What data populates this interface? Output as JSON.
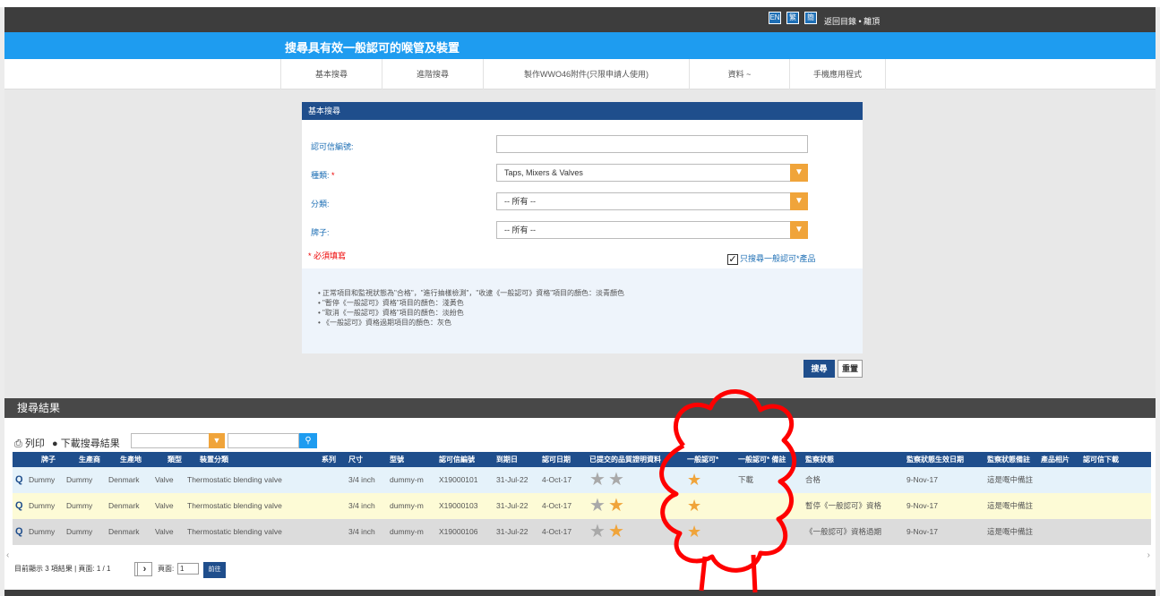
{
  "topbar": {
    "lang_en": "EN",
    "lang_sc": "繁",
    "lang_tc": "簡",
    "links": "返回目錄 • 離頂"
  },
  "header": {
    "title": "搜尋具有效一般認可的喉管及裝置"
  },
  "nav": [
    {
      "label": "基本搜尋"
    },
    {
      "label": "進階搜尋"
    },
    {
      "label": "製作WWO46附件(只限申請人使用)"
    },
    {
      "label": "資料 ~"
    },
    {
      "label": "手機應用程式"
    }
  ],
  "form": {
    "panel_title": "基本搜尋",
    "cert_no_label": "認可信編號:",
    "category_label": "種類:",
    "category_required_mark": "*",
    "category_value": "Taps, Mixers & Valves",
    "subcat_label": "分類:",
    "subcat_value": "-- 所有 --",
    "brand_label": "牌子:",
    "brand_value": "-- 所有 --",
    "required_note": "* 必須填寫",
    "checkbox_label": "只搜尋一般認可*產品",
    "checkbox_checked": true,
    "notes": [
      "• 正常項目和監視狀態為\"合格\"，\"進行抽樣檢測\"，\"收逮《一般認可》資格\"項目的顏色：淡青顏色",
      "• \"暫停《一般認可》資格\"項目的顏色：淺黃色",
      "• \"取消《一般認可》資格\"項目的顏色：淡紛色",
      "• 《一般認可》資格過期項目的顏色：灰色"
    ],
    "search_button": "搜尋",
    "reset_button": "重置"
  },
  "results": {
    "title": "搜尋結果",
    "print_label": "列印",
    "download_label": "下載搜尋結果",
    "columns": [
      "牌子",
      "生產商",
      "生產地",
      "類型",
      "裝置分類",
      "系列",
      "尺寸",
      "型號",
      "認可信編號",
      "到期日",
      "認可日期",
      "已提交的品質證明資料",
      "一般認可*",
      "一般認可* 備註",
      "監察狀態",
      "監察狀態生效日期",
      "監察狀態備註",
      "產品相片",
      "認可信下載"
    ],
    "rows": [
      {
        "brand": "Dummy",
        "maker": "Dummy",
        "origin": "Denmark",
        "type": "Valve",
        "category": "Thermostatic blending valve",
        "series": "",
        "size": "3/4 inch",
        "model": "dummy-m",
        "cert_no": "X19000101",
        "expiry": "31-Jul-22",
        "approval": "4-Oct-17",
        "quality_stars": [
          "grey",
          "grey"
        ],
        "general_approval": true,
        "ga_remark": "下載",
        "status": "合格",
        "status_date": "9-Nov-17",
        "status_remark": "這是嘅中備註",
        "bg": "#e5f2fa"
      },
      {
        "brand": "Dummy",
        "maker": "Dummy",
        "origin": "Denmark",
        "type": "Valve",
        "category": "Thermostatic blending valve",
        "series": "",
        "size": "3/4 inch",
        "model": "dummy-m",
        "cert_no": "X19000103",
        "expiry": "31-Jul-22",
        "approval": "4-Oct-17",
        "quality_stars": [
          "grey",
          "orange"
        ],
        "general_approval": true,
        "ga_remark": "",
        "status": "暫停《一般認可》資格",
        "status_date": "9-Nov-17",
        "status_remark": "這是嘅中備註",
        "bg": "#fdfbd6"
      },
      {
        "brand": "Dummy",
        "maker": "Dummy",
        "origin": "Denmark",
        "type": "Valve",
        "category": "Thermostatic blending valve",
        "series": "",
        "size": "3/4 inch",
        "model": "dummy-m",
        "cert_no": "X19000106",
        "expiry": "31-Jul-22",
        "approval": "4-Oct-17",
        "quality_stars": [
          "grey",
          "orange"
        ],
        "general_approval": true,
        "ga_remark": "",
        "status": "《一般認可》資格過期",
        "status_date": "9-Nov-17",
        "status_remark": "這是嘅中備註",
        "bg": "#dcdcdc"
      }
    ],
    "pager_text": "目前顯示 3 項結果 | 頁面: 1 / 1",
    "page_label": "頁面:",
    "page_value": "1",
    "go_button": "前往"
  },
  "colors": {
    "accent_blue": "#1e9cf0",
    "navy": "#1f4e8c",
    "orange": "#f0a43a",
    "annotation_red": "#ff0000"
  }
}
